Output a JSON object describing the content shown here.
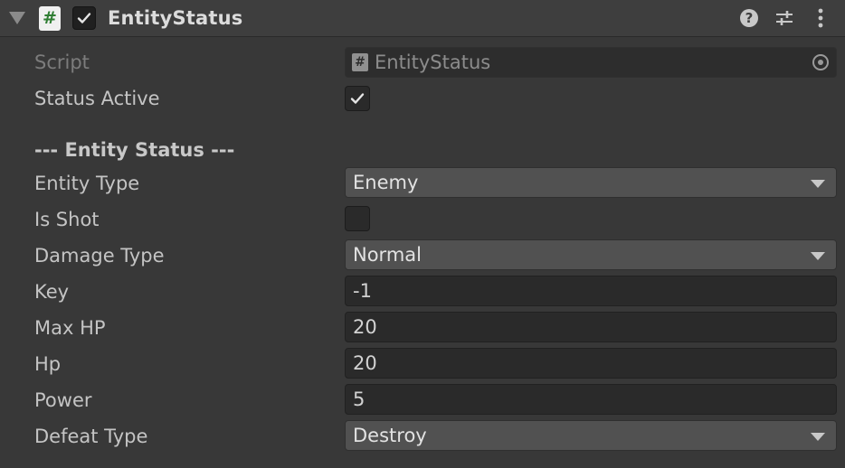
{
  "header": {
    "title": "EntityStatus",
    "script_badge": "#",
    "enabled": true,
    "help_glyph": "?",
    "icons": [
      "foldout-arrow-icon",
      "script-icon",
      "help-icon",
      "presets-icon",
      "context-menu-icon"
    ]
  },
  "script_row": {
    "label": "Script",
    "value": "EntityStatus",
    "icon_glyph": "#"
  },
  "status_active": {
    "label": "Status Active",
    "checked": true
  },
  "section": {
    "title": "--- Entity Status ---"
  },
  "entity_type": {
    "label": "Entity Type",
    "value": "Enemy"
  },
  "is_shot": {
    "label": "Is Shot",
    "checked": false
  },
  "damage_type": {
    "label": "Damage Type",
    "value": "Normal"
  },
  "key": {
    "label": "Key",
    "value": "-1"
  },
  "max_hp": {
    "label": "Max HP",
    "value": "20"
  },
  "hp": {
    "label": "Hp",
    "value": "20"
  },
  "power": {
    "label": "Power",
    "value": "5"
  },
  "defeat_type": {
    "label": "Defeat Type",
    "value": "Destroy"
  },
  "colors": {
    "background": "#383838",
    "header": "#3e3e3e",
    "input_field": "#2a2a2a",
    "dropdown": "#515151",
    "script_badge_green": "#2e7d32"
  }
}
